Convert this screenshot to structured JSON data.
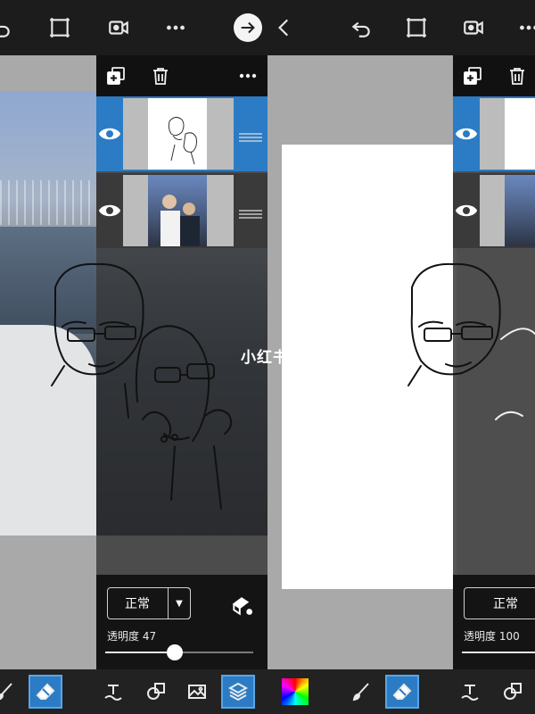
{
  "watermark": "小红书",
  "left_panel": {
    "blend_mode": "正常",
    "opacity_label": "透明度",
    "opacity_value": "47",
    "opacity_fraction": 0.47
  },
  "right_panel": {
    "blend_mode": "正常",
    "opacity_label": "透明度",
    "opacity_value": "100",
    "opacity_fraction": 1.0
  },
  "colors": {
    "accent": "#2b7cc4",
    "toolbar": "#1c1c1c",
    "panel_dark": "#141414"
  },
  "icons": {
    "top": [
      "undo-icon",
      "crop-icon",
      "video-icon",
      "more-icon",
      "forward-arrow-icon"
    ],
    "layers": [
      "add-layer-icon",
      "trash-icon",
      "more-icon"
    ],
    "bottom": [
      "brush-icon",
      "eraser-icon",
      "text-icon",
      "shape-icon",
      "image-icon",
      "layers-icon",
      "color-picker-icon"
    ]
  }
}
